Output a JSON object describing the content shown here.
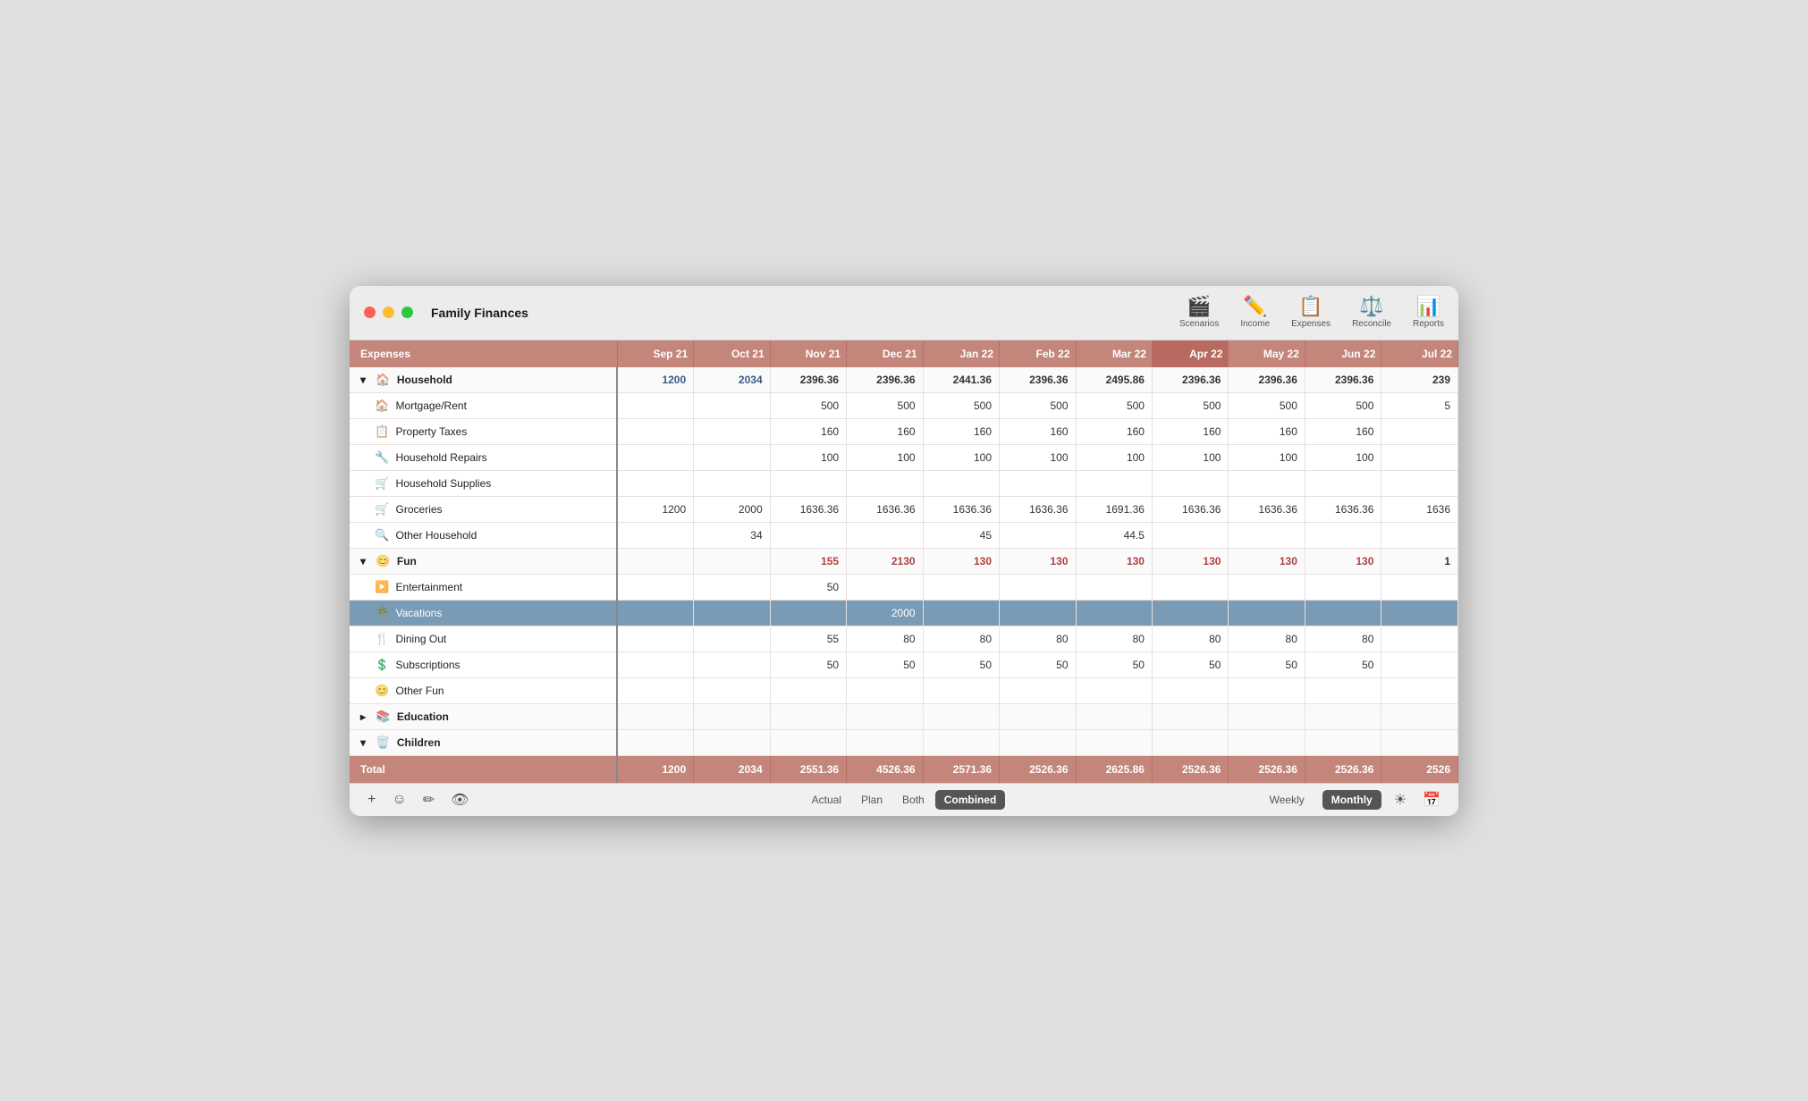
{
  "window": {
    "title": "Family Finances"
  },
  "toolbar": {
    "items": [
      {
        "label": "Scenarios",
        "icon": "🎬",
        "active": false,
        "name": "scenarios"
      },
      {
        "label": "Income",
        "icon": "✏️",
        "active": false,
        "name": "income"
      },
      {
        "label": "Expenses",
        "icon": "📋",
        "active": true,
        "name": "expenses"
      },
      {
        "label": "Reconcile",
        "icon": "⚖️",
        "active": false,
        "name": "reconcile"
      },
      {
        "label": "Reports",
        "icon": "📊",
        "active": false,
        "name": "reports"
      }
    ]
  },
  "table": {
    "columns": [
      {
        "label": "Expenses",
        "key": "label"
      },
      {
        "label": "Sep 21",
        "key": "sep21"
      },
      {
        "label": "Oct 21",
        "key": "oct21"
      },
      {
        "label": "Nov 21",
        "key": "nov21"
      },
      {
        "label": "Dec 21",
        "key": "dec21"
      },
      {
        "label": "Jan 22",
        "key": "jan22"
      },
      {
        "label": "Feb 22",
        "key": "feb22"
      },
      {
        "label": "Mar 22",
        "key": "mar22"
      },
      {
        "label": "Apr 22",
        "key": "apr22",
        "current": true
      },
      {
        "label": "May 22",
        "key": "may22"
      },
      {
        "label": "Jun 22",
        "key": "jun22"
      },
      {
        "label": "Jul 22",
        "key": "jul22"
      }
    ],
    "rows": [
      {
        "type": "group",
        "label": "Household",
        "icon": "🏠",
        "expanded": true,
        "values": [
          "1200",
          "2034",
          "2396.36",
          "2396.36",
          "2441.36",
          "2396.36",
          "2495.86",
          "2396.36",
          "2396.36",
          "2396.36",
          "239"
        ]
      },
      {
        "type": "subitem",
        "label": "Mortgage/Rent",
        "icon": "🏠",
        "values": [
          "",
          "",
          "500",
          "500",
          "500",
          "500",
          "500",
          "500",
          "500",
          "500",
          "5"
        ]
      },
      {
        "type": "subitem",
        "label": "Property Taxes",
        "icon": "📋",
        "values": [
          "",
          "",
          "160",
          "160",
          "160",
          "160",
          "160",
          "160",
          "160",
          "160",
          ""
        ]
      },
      {
        "type": "subitem",
        "label": "Household Repairs",
        "icon": "🔧",
        "values": [
          "",
          "",
          "100",
          "100",
          "100",
          "100",
          "100",
          "100",
          "100",
          "100",
          ""
        ]
      },
      {
        "type": "subitem",
        "label": "Household Supplies",
        "icon": "🛒",
        "values": [
          "",
          "",
          "",
          "",
          "",
          "",
          "",
          "",
          "",
          "",
          ""
        ]
      },
      {
        "type": "subitem",
        "label": "Groceries",
        "icon": "🛒",
        "values": [
          "1200",
          "2000",
          "1636.36",
          "1636.36",
          "1636.36",
          "1636.36",
          "1691.36",
          "1636.36",
          "1636.36",
          "1636.36",
          "1636"
        ]
      },
      {
        "type": "subitem",
        "label": "Other Household",
        "icon": "🔍",
        "values": [
          "",
          "34",
          "",
          "",
          "45",
          "",
          "44.5",
          "",
          "",
          "",
          ""
        ]
      },
      {
        "type": "group",
        "label": "Fun",
        "icon": "😊",
        "expanded": true,
        "values": [
          "",
          "",
          "155",
          "2130",
          "130",
          "130",
          "130",
          "130",
          "130",
          "130",
          "1"
        ]
      },
      {
        "type": "subitem",
        "label": "Entertainment",
        "icon": "▶️",
        "values": [
          "",
          "",
          "50",
          "",
          "",
          "",
          "",
          "",
          "",
          "",
          ""
        ]
      },
      {
        "type": "subitem",
        "label": "Vacations",
        "icon": "🌴",
        "selected": true,
        "values": [
          "",
          "",
          "",
          "2000",
          "",
          "",
          "",
          "",
          "",
          "",
          ""
        ]
      },
      {
        "type": "subitem",
        "label": "Dining Out",
        "icon": "🍴",
        "values": [
          "",
          "",
          "55",
          "80",
          "80",
          "80",
          "80",
          "80",
          "80",
          "80",
          ""
        ]
      },
      {
        "type": "subitem",
        "label": "Subscriptions",
        "icon": "💲",
        "values": [
          "",
          "",
          "50",
          "50",
          "50",
          "50",
          "50",
          "50",
          "50",
          "50",
          ""
        ]
      },
      {
        "type": "subitem",
        "label": "Other Fun",
        "icon": "😊",
        "values": [
          "",
          "",
          "",
          "",
          "",
          "",
          "",
          "",
          "",
          "",
          ""
        ]
      },
      {
        "type": "group",
        "label": "Education",
        "icon": "📚",
        "expanded": false,
        "values": [
          "",
          "",
          "",
          "",
          "",
          "",
          "",
          "",
          "",
          "",
          ""
        ]
      },
      {
        "type": "group",
        "label": "Children",
        "icon": "🗑️",
        "expanded": true,
        "values": [
          "",
          "",
          "",
          "",
          "",
          "",
          "",
          "",
          "",
          "",
          ""
        ]
      }
    ],
    "totals": {
      "label": "Total",
      "values": [
        "1200",
        "2034",
        "2551.36",
        "4526.36",
        "2571.36",
        "2526.36",
        "2625.86",
        "2526.36",
        "2526.36",
        "2526.36",
        "2526"
      ]
    }
  },
  "bottombar": {
    "left": {
      "add_label": "+",
      "emoji_label": "☺",
      "pencil_label": "✏",
      "eye_label": "👁"
    },
    "view_tabs": [
      {
        "label": "Actual",
        "active": false
      },
      {
        "label": "Plan",
        "active": false
      },
      {
        "label": "Both",
        "active": false
      },
      {
        "label": "Combined",
        "active": true
      }
    ],
    "period_tabs": [
      {
        "label": "Weekly",
        "active": false
      },
      {
        "label": "Monthly",
        "active": true
      }
    ],
    "right_icons": [
      "☀",
      "📅"
    ]
  }
}
